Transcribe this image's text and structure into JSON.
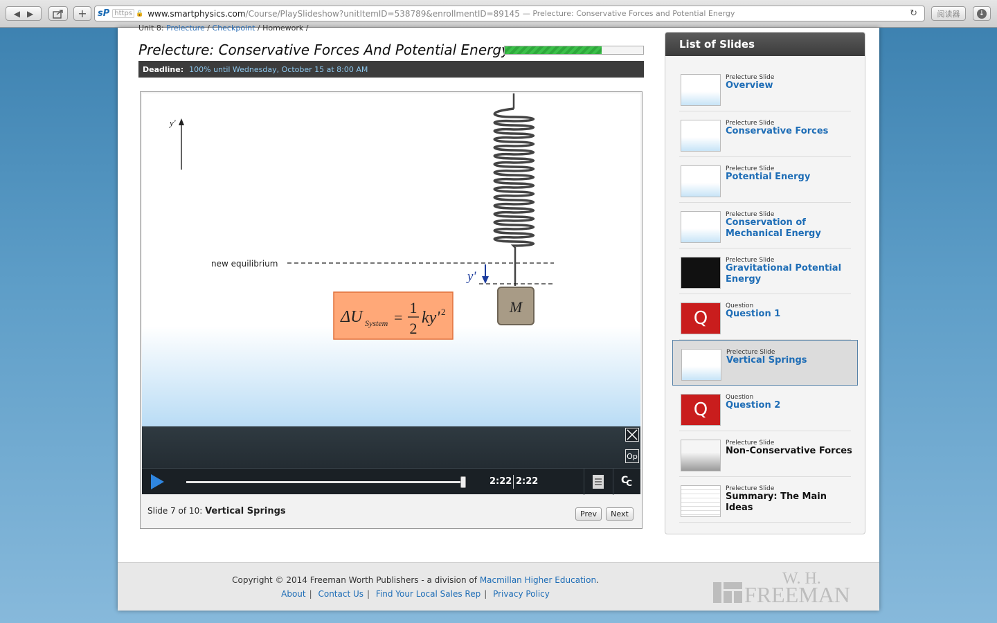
{
  "browser": {
    "url_scheme": "https",
    "url_domain": "www.smartphysics.com",
    "url_path": "/Course/PlaySlideshow?unitItemID=538789&enrollmentID=89145",
    "url_title": "— Prelecture: Conservative Forces and Potential Energy",
    "reader_label": "阅读器"
  },
  "breadcrumb": {
    "unit": "Unit 8:",
    "prelecture": "Prelecture",
    "checkpoint": "Checkpoint",
    "homework": "Homework",
    "sep": "/"
  },
  "page": {
    "title": "Prelecture: Conservative Forces And Potential Energy",
    "progress": 0.7,
    "deadline_label": "Deadline:",
    "deadline_value": "100% until Wednesday, October 15 at 8:00 AM"
  },
  "slide": {
    "axis_label": "y'",
    "equilibrium_label": "new equilibrium",
    "displacement_label": "y'",
    "mass_label": "M",
    "equation": {
      "delta": "ΔU",
      "sub": "System",
      "eq": "=",
      "num": "1",
      "den": "2",
      "rhs": "ky'",
      "exp": "2"
    }
  },
  "player": {
    "time_current": "2:22",
    "time_total": "2:22",
    "seek_progress": 1.0,
    "options_label": "Op",
    "cc_label": "C",
    "slide_counter": "Slide 7 of 10:",
    "slide_name": "Vertical Springs",
    "prev_label": "Prev",
    "next_label": "Next"
  },
  "sidebar": {
    "title": "List of Slides",
    "items": [
      {
        "type": "Prelecture Slide",
        "name": "Overview",
        "thumb": "slide"
      },
      {
        "type": "Prelecture Slide",
        "name": "Conservative Forces",
        "thumb": "slide"
      },
      {
        "type": "Prelecture Slide",
        "name": "Potential Energy",
        "thumb": "slide"
      },
      {
        "type": "Prelecture Slide",
        "name": "Conservation of Mechanical Energy",
        "thumb": "slide"
      },
      {
        "type": "Prelecture Slide",
        "name": "Gravitational Potential Energy",
        "thumb": "dark"
      },
      {
        "type": "Question",
        "name": "Question 1",
        "thumb": "question"
      },
      {
        "type": "Prelecture Slide",
        "name": "Vertical Springs",
        "thumb": "slide"
      },
      {
        "type": "Question",
        "name": "Question 2",
        "thumb": "question"
      },
      {
        "type": "Prelecture Slide",
        "name": "Non-Conservative Forces",
        "thumb": "grey"
      },
      {
        "type": "Prelecture Slide",
        "name": "Summary: The Main Ideas",
        "thumb": "table"
      }
    ],
    "active_index": 6,
    "question_glyph": "Q"
  },
  "footer": {
    "copyright": "Copyright © 2014 Freeman Worth Publishers - a division of",
    "copyright_link": "Macmillan Higher Education",
    "copyright_end": ".",
    "links": [
      "About",
      "Contact Us",
      "Find Your Local Sales Rep",
      "Privacy Policy"
    ],
    "logo_line1": "W. H.",
    "logo_line2": "FREEMAN"
  },
  "colors": {
    "accent": "#1e6db6",
    "progress": "#3cc04a",
    "question": "#c91d1d",
    "equation_bg": "#ffa878"
  }
}
